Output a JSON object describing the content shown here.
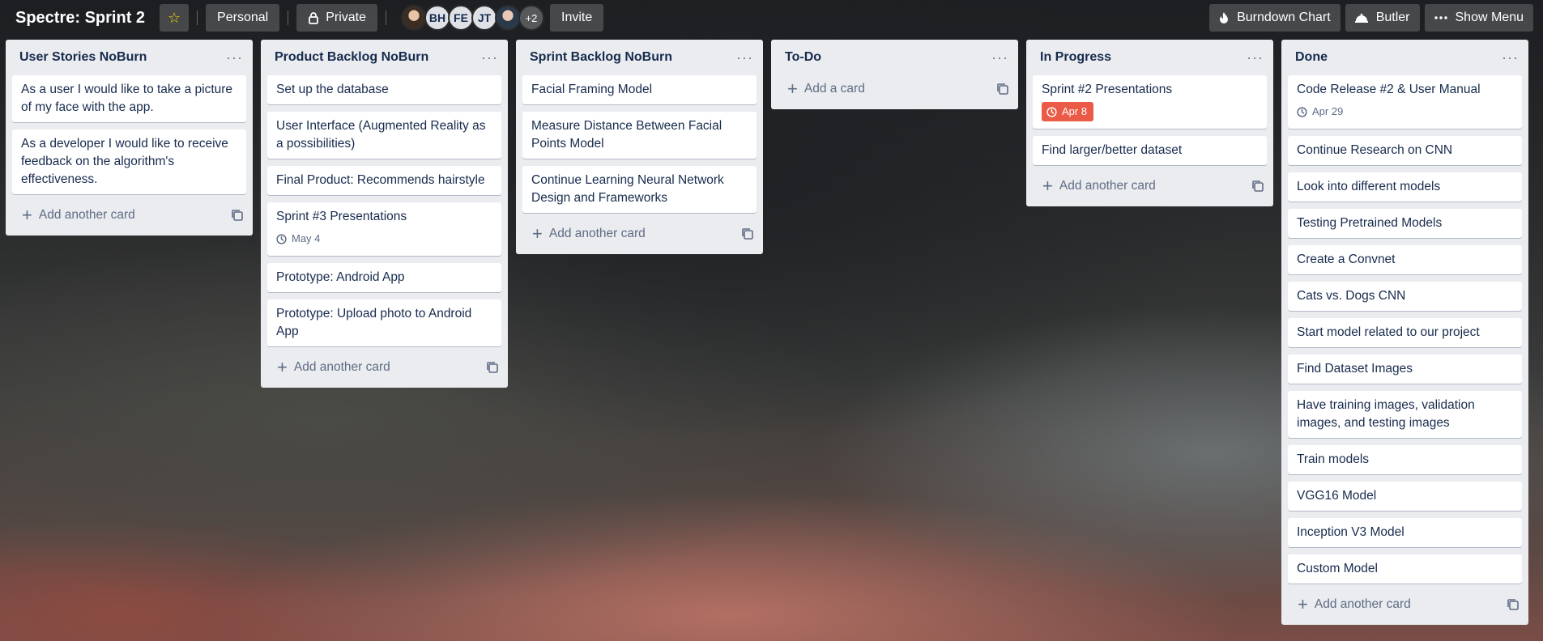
{
  "header": {
    "board_title": "Spectre: Sprint 2",
    "personal_label": "Personal",
    "private_label": "Private",
    "members": [
      {
        "initials": "",
        "kind": "photo1"
      },
      {
        "initials": "BH",
        "kind": "initials"
      },
      {
        "initials": "FE",
        "kind": "initials"
      },
      {
        "initials": "JT",
        "kind": "initials"
      },
      {
        "initials": "",
        "kind": "photo2"
      }
    ],
    "more_members": "+2",
    "invite_label": "Invite",
    "burndown_label": "Burndown Chart",
    "butler_label": "Butler",
    "show_menu_label": "Show Menu"
  },
  "lists": [
    {
      "title": "User Stories NoBurn",
      "cards": [
        {
          "text": "As a user I would like to take a picture of my face with the app."
        },
        {
          "text": "As a developer I would like to receive feedback on the algorithm's effectiveness."
        }
      ],
      "add_label": "Add another card"
    },
    {
      "title": "Product Backlog NoBurn",
      "cards": [
        {
          "text": "Set up the database"
        },
        {
          "text": "User Interface (Augmented Reality as a possibilities)"
        },
        {
          "text": "Final Product: Recommends hairstyle"
        },
        {
          "text": "Sprint #3 Presentations",
          "badge": "May 4"
        },
        {
          "text": "Prototype: Android App"
        },
        {
          "text": "Prototype: Upload photo to Android App"
        }
      ],
      "add_label": "Add another card"
    },
    {
      "title": "Sprint Backlog NoBurn",
      "cards": [
        {
          "text": "Facial Framing Model"
        },
        {
          "text": "Measure Distance Between Facial Points Model"
        },
        {
          "text": "Continue Learning Neural Network Design and Frameworks"
        }
      ],
      "add_label": "Add another card"
    },
    {
      "title": "To-Do",
      "cards": [],
      "add_label": "Add a card"
    },
    {
      "title": "In Progress",
      "cards": [
        {
          "text": "Sprint #2 Presentations",
          "badge": "Apr 8",
          "badge_due": true
        },
        {
          "text": "Find larger/better dataset"
        }
      ],
      "add_label": "Add another card"
    },
    {
      "title": "Done",
      "cards": [
        {
          "text": "Code Release #2 & User Manual",
          "badge": "Apr 29"
        },
        {
          "text": "Continue Research on CNN"
        },
        {
          "text": "Look into different models"
        },
        {
          "text": "Testing Pretrained Models"
        },
        {
          "text": "Create a Convnet"
        },
        {
          "text": "Cats vs. Dogs CNN"
        },
        {
          "text": "Start model related to our project"
        },
        {
          "text": "Find Dataset Images"
        },
        {
          "text": "Have training images, validation images, and testing images"
        },
        {
          "text": "Train models"
        },
        {
          "text": "VGG16 Model"
        },
        {
          "text": "Inception V3 Model"
        },
        {
          "text": "Custom Model"
        }
      ],
      "add_label": "Add another card"
    }
  ]
}
